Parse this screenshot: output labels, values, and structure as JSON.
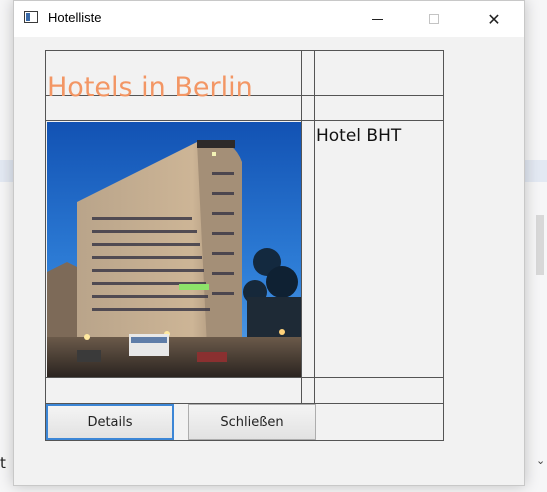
{
  "window": {
    "title": "Hotelliste",
    "controls": {
      "minimize": "minimize-icon",
      "maximize": "maximize-icon",
      "close_glyph": "✕"
    }
  },
  "main": {
    "heading": "Hotels in Berlin",
    "hotel_name": "Hotel BHT",
    "buttons": {
      "details_label": "Details",
      "close_label": "Schließen"
    }
  },
  "background": {
    "partial_text": "t"
  },
  "colors": {
    "heading": "#f39664",
    "focus_border": "#3c86d6"
  }
}
